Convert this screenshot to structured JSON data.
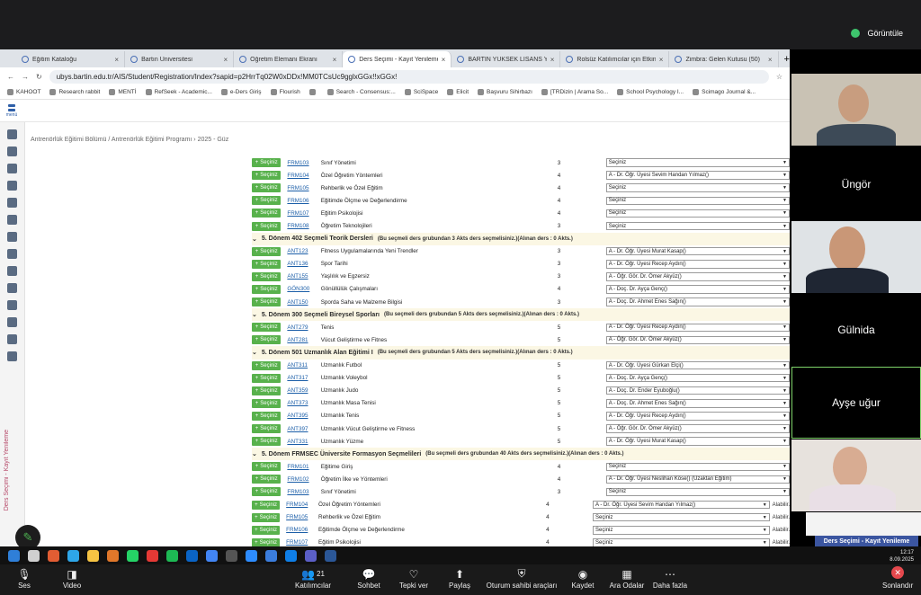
{
  "screen_share": {
    "label": "Görüntüle"
  },
  "browser": {
    "tabs": [
      {
        "label": "Eğitim Kataloğu",
        "active": false
      },
      {
        "label": "Bartın Üniversitesi",
        "active": false
      },
      {
        "label": "Öğretim Elemanı Ekranı",
        "active": false
      },
      {
        "label": "Ders Seçimi - Kayıt Yenileme",
        "active": true
      },
      {
        "label": "BARTIN YÜKSEK LİSANS YÖNT",
        "active": false
      },
      {
        "label": "Rolsüz Katılımcılar için Etkinlik",
        "active": false
      },
      {
        "label": "Zimbra: Gelen Kutusu (50)",
        "active": false
      }
    ],
    "url": "ubys.bartin.edu.tr/AIS/Student/Registration/Index?sapid=p2HrrTq02W0xDDx!MM0TCsUc9gglxGGx!!xGGx!",
    "bookmarks": [
      "KAHOOT",
      "Research rabbit",
      "MENTİ",
      "RefSeek - Academic...",
      "e-Ders Giriş",
      "Flourish",
      "",
      "Search - Consensus:...",
      "SciSpace",
      "Elicit",
      "Başvuru Sihirbazı",
      "[TRDizin | Arama So...",
      "School Psychology I...",
      "Scimago Journal &..."
    ]
  },
  "app": {
    "menu_label": "menü",
    "breadcrumb": "Antrenörlük Eğitimi Bölümü / Antrenörlük Eğitimi Programı  ›  2025 - Güz",
    "sidebar_vertical_label": "Ders Seçimi - Kayıt Yenileme",
    "select_button": "Seçiniz",
    "alabilir": "Alabilir."
  },
  "rows": [
    {
      "type": "course",
      "code": "FRM103",
      "name": "Sınıf Yönetimi",
      "akts": "3",
      "sel": "Seçiniz"
    },
    {
      "type": "course",
      "code": "FRM104",
      "name": "Özel Öğretim Yöntemleri",
      "akts": "4",
      "sel": "A - Dr. Öğr. Üyesi Sevim Handan Yılmaz()"
    },
    {
      "type": "course",
      "code": "FRM105",
      "name": "Rehberlik ve Özel Eğitim",
      "akts": "4",
      "sel": "Seçiniz"
    },
    {
      "type": "course",
      "code": "FRM106",
      "name": "Eğitimde Ölçme ve Değerlendirme",
      "akts": "4",
      "sel": "Seçiniz"
    },
    {
      "type": "course",
      "code": "FRM107",
      "name": "Eğitim Psikolojisi",
      "akts": "4",
      "sel": "Seçiniz"
    },
    {
      "type": "course",
      "code": "FRM108",
      "name": "Öğretim Teknolojileri",
      "akts": "3",
      "sel": "Seçiniz"
    },
    {
      "type": "group",
      "title": "5. Dönem 402 Seçmeli Teorik Dersleri",
      "note": "(Bu seçmeli ders grubundan 3 Akts ders seçmelisiniz.)(Alınan ders : 0 Akts.)"
    },
    {
      "type": "course",
      "code": "ANT123",
      "name": "Fitness Uygulamalarında Yeni Trendler",
      "akts": "3",
      "sel": "A - Dr. Öğr. Üyesi Murat Kasap()"
    },
    {
      "type": "course",
      "code": "ANT136",
      "name": "Spor Tarihi",
      "akts": "3",
      "sel": "A - Dr. Öğr. Üyesi Recep Aydın()"
    },
    {
      "type": "course",
      "code": "ANT155",
      "name": "Yaşlılık ve Egzersiz",
      "akts": "3",
      "sel": "A - Öğr. Gör. Dr. Ömer Akyüz()"
    },
    {
      "type": "course",
      "code": "GÖN300",
      "name": "Gönüllülük Çalışmaları",
      "akts": "4",
      "sel": "A - Doç. Dr. Ayça Genç()"
    },
    {
      "type": "course",
      "code": "ANT150",
      "name": "Sporda Saha ve Malzeme Bilgisi",
      "akts": "3",
      "sel": "A - Doç. Dr. Ahmet Enes Sağın()"
    },
    {
      "type": "group",
      "title": "5. Dönem 300 Seçmeli Bireysel Sporları",
      "note": "(Bu seçmeli ders grubundan 5 Akts ders seçmelisiniz.)(Alınan ders : 0 Akts.)"
    },
    {
      "type": "course",
      "code": "ANT279",
      "name": "Tenis",
      "akts": "5",
      "sel": "A - Dr. Öğr. Üyesi Recep Aydın()"
    },
    {
      "type": "course",
      "code": "ANT281",
      "name": "Vücut Geliştirme ve Fitnes",
      "akts": "5",
      "sel": "A - Öğr. Gör. Dr. Ömer Akyüz()"
    },
    {
      "type": "group",
      "title": "5. Dönem 501 Uzmanlık Alan Eğitimi I",
      "note": "(Bu seçmeli ders grubundan 5 Akts ders seçmelisiniz.)(Alınan ders : 0 Akts.)"
    },
    {
      "type": "course",
      "code": "ANT311",
      "name": "Uzmanlık Futbol",
      "akts": "5",
      "sel": "A - Dr. Öğr. Üyesi Gürkan Elçi()"
    },
    {
      "type": "course",
      "code": "ANT317",
      "name": "Uzmanlık Voleybol",
      "akts": "5",
      "sel": "A - Doç. Dr. Ayça Genç()"
    },
    {
      "type": "course",
      "code": "ANT359",
      "name": "Uzmanlık Judo",
      "akts": "5",
      "sel": "A - Doç. Dr. Ender Eyuboğlu()"
    },
    {
      "type": "course",
      "code": "ANT373",
      "name": "Uzmanlık Masa Tenisi",
      "akts": "5",
      "sel": "A - Doç. Dr. Ahmet Enes Sağın()"
    },
    {
      "type": "course",
      "code": "ANT395",
      "name": "Uzmanlık Tenis",
      "akts": "5",
      "sel": "A - Dr. Öğr. Üyesi Recep Aydın()"
    },
    {
      "type": "course",
      "code": "ANT397",
      "name": "Uzmanlık Vücut Geliştirme ve Fitness",
      "akts": "5",
      "sel": "A - Öğr. Gör. Dr. Ömer Akyüz()"
    },
    {
      "type": "course",
      "code": "ANT331",
      "name": "Uzmanlık Yüzme",
      "akts": "5",
      "sel": "A - Dr. Öğr. Üyesi Murat Kasap()"
    },
    {
      "type": "group",
      "title": "5. Dönem FRMSEC Üniversite Formasyon Seçmelileri",
      "note": "(Bu seçmeli ders grubundan 40 Akts ders seçmelisiniz.)(Alınan ders : 0 Akts.)"
    },
    {
      "type": "course",
      "code": "FRM101",
      "name": "Eğitime Giriş",
      "akts": "4",
      "sel": "Seçiniz"
    },
    {
      "type": "course",
      "code": "FRM102",
      "name": "Öğretim İlke ve Yöntemleri",
      "akts": "4",
      "sel": "A - Dr. Öğr. Üyesi Neslihan Köse() (Uzaktan Eğitim)"
    },
    {
      "type": "course",
      "code": "FRM103",
      "name": "Sınıf Yönetimi",
      "akts": "3",
      "sel": "Seçiniz"
    },
    {
      "type": "course",
      "code": "FRM104",
      "name": "Özel Öğretim Yöntemleri",
      "akts": "4",
      "sel": "A - Dr. Öğr. Üyesi Sevim Handan Yılmaz()"
    },
    {
      "type": "course",
      "code": "FRM105",
      "name": "Rehberlik ve Özel Eğitim",
      "akts": "4",
      "sel": "Seçiniz"
    },
    {
      "type": "course",
      "code": "FRM106",
      "name": "Eğitimde Ölçme ve Değerlendirme",
      "akts": "4",
      "sel": "Seçiniz"
    },
    {
      "type": "course",
      "code": "FRM107",
      "name": "Eğitim Psikolojisi",
      "akts": "4",
      "sel": "Seçiniz"
    }
  ],
  "participants": [
    {
      "name": "",
      "kind": "camera"
    },
    {
      "name": "Üngör",
      "kind": "name"
    },
    {
      "name": "",
      "kind": "camera"
    },
    {
      "name": "Gülnida",
      "kind": "name"
    },
    {
      "name": "Ayşe uğur",
      "kind": "name",
      "speaking": true
    },
    {
      "name": "",
      "kind": "camera"
    }
  ],
  "share_pill": "Ders Seçimi - Kayıt Yenileme",
  "clock": {
    "time": "12:17",
    "date": "8.09.2025"
  },
  "zoom_bar": {
    "items": [
      {
        "label": "Ses",
        "icon": "mic-icon"
      },
      {
        "label": "Video",
        "icon": "video-icon"
      },
      {
        "label": "Katılımcılar",
        "icon": "participants-icon",
        "count": "21"
      },
      {
        "label": "Sohbet",
        "icon": "chat-icon"
      },
      {
        "label": "Tepki ver",
        "icon": "heart-icon"
      },
      {
        "label": "Paylaş",
        "icon": "share-icon"
      },
      {
        "label": "Oturum sahibi araçları",
        "icon": "shield-icon"
      },
      {
        "label": "Kaydet",
        "icon": "record-icon"
      },
      {
        "label": "Ara Odalar",
        "icon": "rooms-icon"
      },
      {
        "label": "Daha fazla",
        "icon": "more-icon"
      }
    ],
    "end_label": "Sonlandır"
  },
  "colors": {
    "select_green": "#58b14c",
    "link_blue": "#1b5ea8",
    "group_bg": "#fbf7e4",
    "active_tile": "#7fd36a",
    "end_red": "#e5484d"
  }
}
